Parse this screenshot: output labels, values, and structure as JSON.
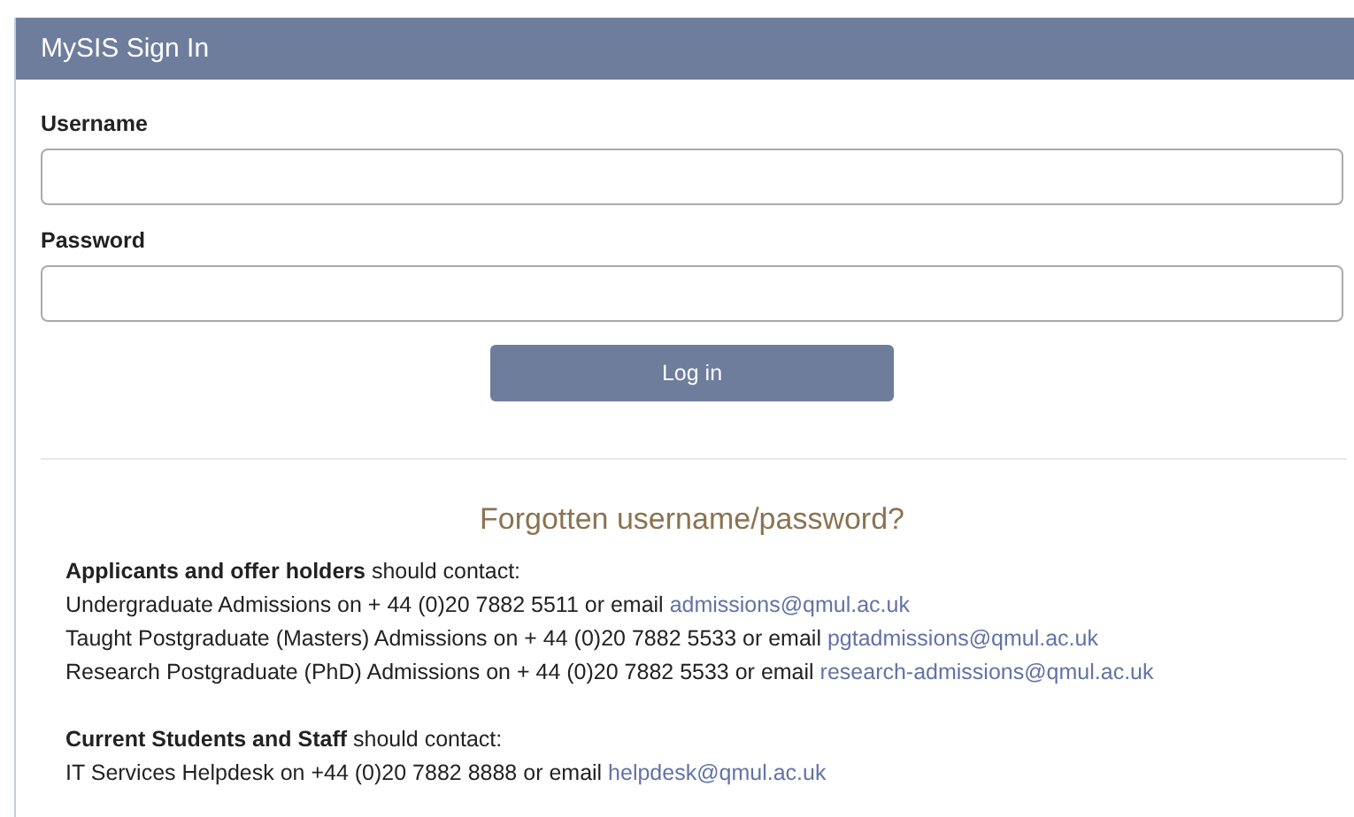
{
  "panel": {
    "title": "MySIS Sign In"
  },
  "fields": [
    {
      "label": "Username"
    },
    {
      "label": "Password"
    }
  ],
  "login_button": "Log in",
  "help": {
    "title": "Forgotten username/password?",
    "sections": [
      {
        "heading": "**Applicants and offer holders** should contact:",
        "lines": [
          {
            "text": "Undergraduate Admissions on + 44 (0)20 7882 5511 or email",
            "email": "admissions@qmul.ac.uk"
          },
          {
            "text": "Taught Postgraduate (Masters) Admissions on + 44 (0)20 7882 5533 or email",
            "email": "pgtadmissions@qmul.ac.uk"
          },
          {
            "text": "Research Postgraduate (PhD) Admissions on + 44 (0)20 7882 5533 or email",
            "email": "research-admissions@qmul.ac.uk"
          }
        ]
      },
      {
        "heading": "**Current Students and Staff** should contact:",
        "lines": [
          {
            "text": "IT Services Helpdesk on +44 (0)20 7882 8888 or email",
            "email": "helpdesk@qmul.ac.uk"
          }
        ]
      }
    ]
  }
}
